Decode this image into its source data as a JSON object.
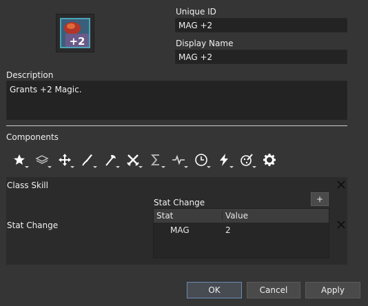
{
  "item": {
    "icon_name": "mag-plus-two-icon",
    "unique_id_label": "Unique ID",
    "unique_id_value": "MAG +2",
    "display_name_label": "Display Name",
    "display_name_value": "MAG +2",
    "description_label": "Description",
    "description_value": "Grants +2 Magic."
  },
  "components": {
    "title": "Components",
    "tools": [
      {
        "icon": "star-icon"
      },
      {
        "icon": "layers-icon"
      },
      {
        "icon": "move-arrows-icon"
      },
      {
        "icon": "sword-icon"
      },
      {
        "icon": "axe-icon"
      },
      {
        "icon": "crossed-swords-icon"
      },
      {
        "icon": "sigma-icon"
      },
      {
        "icon": "pulse-icon"
      },
      {
        "icon": "clock-icon"
      },
      {
        "icon": "lightning-icon"
      },
      {
        "icon": "palette-icon"
      },
      {
        "icon": "gear-icon"
      }
    ]
  },
  "component_list": {
    "class_skill_label": "Class Skill",
    "stat_change_label": "Stat Change",
    "stat_change_inner_label": "Stat Change",
    "add_button_label": "+",
    "table": {
      "headers": [
        "Stat",
        "Value"
      ],
      "rows": [
        [
          "MAG",
          "2"
        ]
      ]
    }
  },
  "buttons": {
    "ok": "OK",
    "cancel": "Cancel",
    "apply": "Apply"
  },
  "colors": {
    "background": "#353535",
    "accent_border": "#6b8cb3"
  }
}
